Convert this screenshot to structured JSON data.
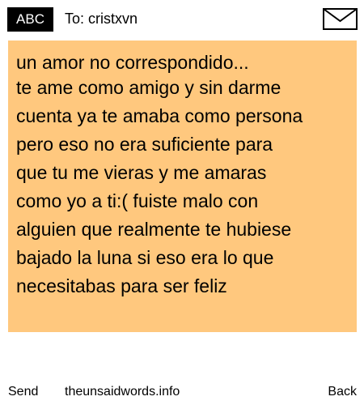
{
  "header": {
    "mode_label": "ABC",
    "to_text": "To: cristxvn",
    "envelope_icon": "envelope-icon"
  },
  "message": {
    "title": "un amor no correspondido...",
    "body": "te ame como amigo y sin darme\ncuenta ya te amaba como persona\npero eso no era suficiente para\nque tu me vieras y me amaras\ncomo yo a ti:( fuiste malo con\nalguien que realmente te hubiese\nbajado la luna si eso era lo que\nnecesitabas para ser feliz",
    "background": "#ffc87e"
  },
  "footer": {
    "send_label": "Send",
    "site_label": "theunsaidwords.info",
    "back_label": "Back"
  }
}
